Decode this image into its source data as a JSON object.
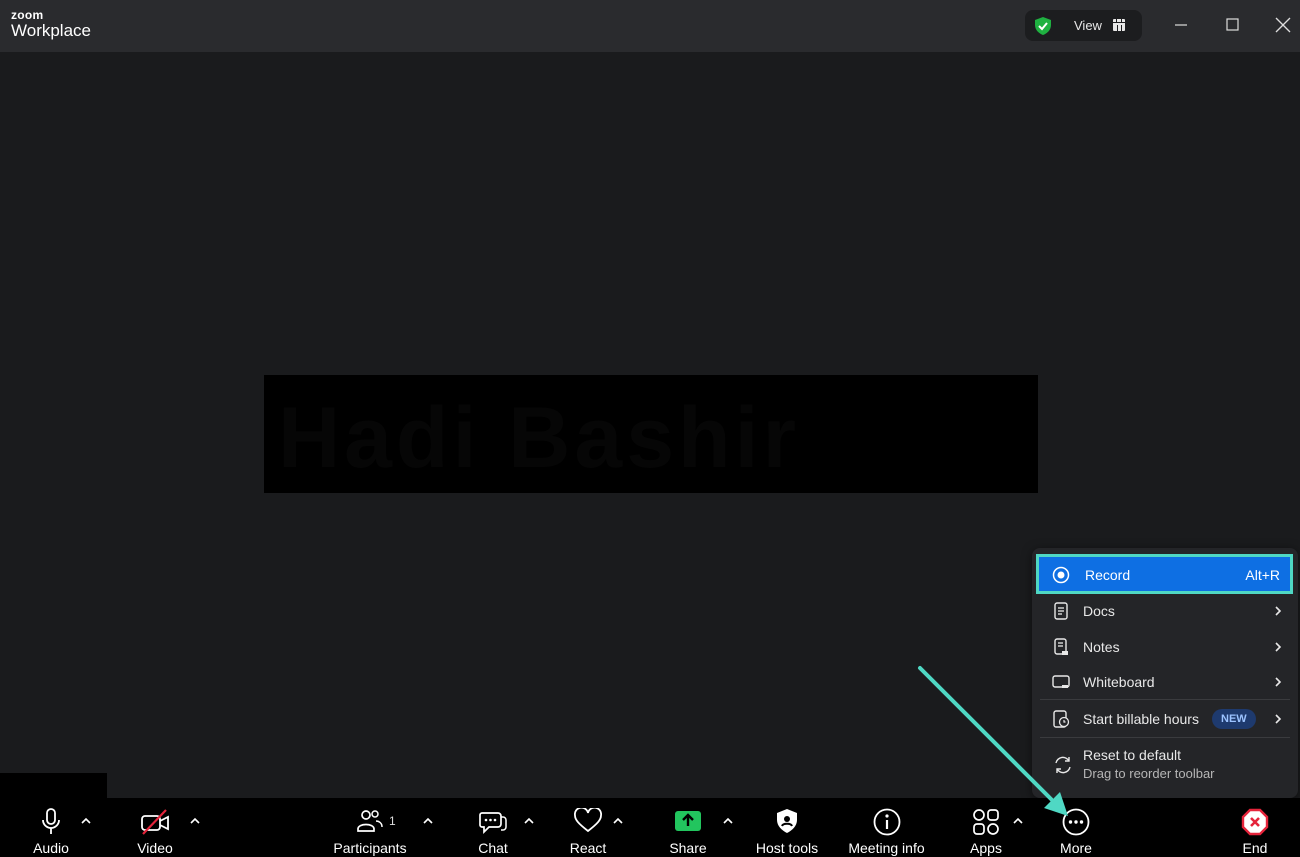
{
  "app": {
    "logo_top": "zoom",
    "logo_bottom": "Workplace"
  },
  "titlebar": {
    "view_label": "View",
    "icons": [
      "security-shield-icon",
      "grid-view-icon",
      "minimize-icon",
      "maximize-icon",
      "close-icon"
    ]
  },
  "stage": {
    "participant_name": "Hadi Bashir",
    "name_box_color": "#000000"
  },
  "toolbar": {
    "audio": "Audio",
    "video": "Video",
    "participants": "Participants",
    "participants_count": "1",
    "chat": "Chat",
    "react": "React",
    "share": "Share",
    "host_tools": "Host tools",
    "meeting_info": "Meeting info",
    "apps": "Apps",
    "more": "More",
    "end": "End"
  },
  "more_menu": {
    "record": "Record",
    "record_shortcut": "Alt+R",
    "docs": "Docs",
    "notes": "Notes",
    "whiteboard": "Whiteboard",
    "billable": "Start billable hours",
    "billable_badge": "NEW",
    "reset": "Reset to default",
    "reset_sub": "Drag to reorder toolbar"
  },
  "colors": {
    "accent_blue": "#0e6fe3",
    "highlight_teal": "#4fd8c4",
    "share_green": "#22c55e",
    "end_red": "#e5243b",
    "shield_green": "#1fb141"
  }
}
